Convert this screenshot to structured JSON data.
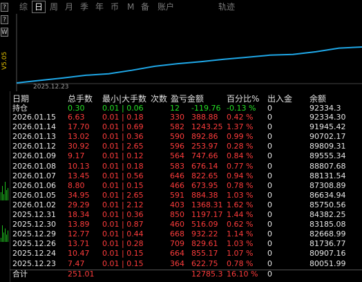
{
  "left_strip": {
    "buttons": [
      "?",
      "?",
      "W"
    ],
    "version": "V5.05",
    "volume_bars": [
      0.4,
      0.7,
      0.3,
      0.9,
      0.5,
      0.6,
      0.2,
      0.8,
      0.45,
      0.65,
      0.35,
      0.55
    ]
  },
  "tabs": [
    {
      "label": "综",
      "active": false
    },
    {
      "label": "日",
      "active": true
    },
    {
      "label": "周",
      "active": false
    },
    {
      "label": "月",
      "active": false
    },
    {
      "label": "季",
      "active": false
    },
    {
      "label": "年",
      "active": false
    },
    {
      "label": "币",
      "active": false
    },
    {
      "label": "M",
      "active": false
    },
    {
      "label": "备",
      "active": false
    },
    {
      "label": "账户",
      "active": false
    },
    {
      "label": "轨迹",
      "active": false
    }
  ],
  "chart": {
    "start_date": "2025.12.23",
    "line_color": "#1fa8e8",
    "values": [
      80051.99,
      80907.16,
      81736.77,
      82668.99,
      83185.08,
      84382.25,
      85750.56,
      86634.94,
      87308.89,
      88131.54,
      88807.68,
      89555.34,
      89809.31,
      90702.17,
      91945.42,
      92334.3
    ]
  },
  "table": {
    "headers": [
      "日期",
      "总手数",
      "最小|大手数",
      "次数",
      "盈亏金额",
      "百分比%",
      "出入金",
      "余额"
    ],
    "holding": {
      "date": "持仓",
      "lots": "0.30",
      "minmax": "0.01 | 0.06",
      "count": "12",
      "pnl": "-119.76",
      "pct": "-0.13 %",
      "flow": "0",
      "balance": "92334.3"
    },
    "rows": [
      {
        "date": "2026.01.15",
        "lots": "6.63",
        "minmax": "0.01 | 0.18",
        "count": "330",
        "pnl": "388.88",
        "pct": "0.42 %",
        "flow": "0",
        "balance": "92334.30"
      },
      {
        "date": "2026.01.14",
        "lots": "17.70",
        "minmax": "0.01 | 0.69",
        "count": "582",
        "pnl": "1243.25",
        "pct": "1.37 %",
        "flow": "0",
        "balance": "91945.42"
      },
      {
        "date": "2026.01.13",
        "lots": "13.02",
        "minmax": "0.01 | 0.36",
        "count": "590",
        "pnl": "892.86",
        "pct": "0.99 %",
        "flow": "0",
        "balance": "90702.17"
      },
      {
        "date": "2026.01.12",
        "lots": "30.92",
        "minmax": "0.01 | 2.65",
        "count": "596",
        "pnl": "253.97",
        "pct": "0.28 %",
        "flow": "0",
        "balance": "89809.31"
      },
      {
        "date": "2026.01.09",
        "lots": "9.17",
        "minmax": "0.01 | 0.12",
        "count": "564",
        "pnl": "747.66",
        "pct": "0.84 %",
        "flow": "0",
        "balance": "89555.34"
      },
      {
        "date": "2026.01.08",
        "lots": "10.13",
        "minmax": "0.01 | 0.18",
        "count": "583",
        "pnl": "676.14",
        "pct": "0.77 %",
        "flow": "0",
        "balance": "88807.68"
      },
      {
        "date": "2026.01.07",
        "lots": "13.45",
        "minmax": "0.01 | 0.56",
        "count": "646",
        "pnl": "822.65",
        "pct": "0.94 %",
        "flow": "0",
        "balance": "88131.54"
      },
      {
        "date": "2026.01.06",
        "lots": "8.80",
        "minmax": "0.01 | 0.15",
        "count": "466",
        "pnl": "673.95",
        "pct": "0.78 %",
        "flow": "0",
        "balance": "87308.89"
      },
      {
        "date": "2026.01.05",
        "lots": "34.95",
        "minmax": "0.01 | 2.65",
        "count": "591",
        "pnl": "884.38",
        "pct": "1.03 %",
        "flow": "0",
        "balance": "86634.94"
      },
      {
        "date": "2026.01.02",
        "lots": "29.29",
        "minmax": "0.01 | 2.12",
        "count": "403",
        "pnl": "1368.31",
        "pct": "1.62 %",
        "flow": "0",
        "balance": "85750.56"
      },
      {
        "date": "2025.12.31",
        "lots": "18.34",
        "minmax": "0.01 | 0.36",
        "count": "850",
        "pnl": "1197.17",
        "pct": "1.44 %",
        "flow": "0",
        "balance": "84382.25"
      },
      {
        "date": "2025.12.30",
        "lots": "13.89",
        "minmax": "0.01 | 0.87",
        "count": "460",
        "pnl": "516.09",
        "pct": "0.62 %",
        "flow": "0",
        "balance": "83185.08"
      },
      {
        "date": "2025.12.29",
        "lots": "12.77",
        "minmax": "0.01 | 0.44",
        "count": "668",
        "pnl": "932.22",
        "pct": "1.14 %",
        "flow": "0",
        "balance": "82668.99"
      },
      {
        "date": "2025.12.26",
        "lots": "13.71",
        "minmax": "0.01 | 0.28",
        "count": "709",
        "pnl": "829.61",
        "pct": "1.03 %",
        "flow": "0",
        "balance": "81736.77"
      },
      {
        "date": "2025.12.24",
        "lots": "10.47",
        "minmax": "0.01 | 0.15",
        "count": "664",
        "pnl": "855.17",
        "pct": "1.07 %",
        "flow": "0",
        "balance": "80907.16"
      },
      {
        "date": "2025.12.23",
        "lots": "7.47",
        "minmax": "0.01 | 0.15",
        "count": "364",
        "pnl": "622.75",
        "pct": "0.78 %",
        "flow": "0",
        "balance": "80051.99"
      }
    ],
    "total": {
      "date": "合计",
      "lots": "251.01",
      "pnl": "12785.3",
      "pct": "16.10 %",
      "flow": "0"
    }
  },
  "colors": {
    "profit": "#ff3c3c",
    "holding": "#25e025",
    "text": "#e8e8e8",
    "background": "#000000"
  }
}
